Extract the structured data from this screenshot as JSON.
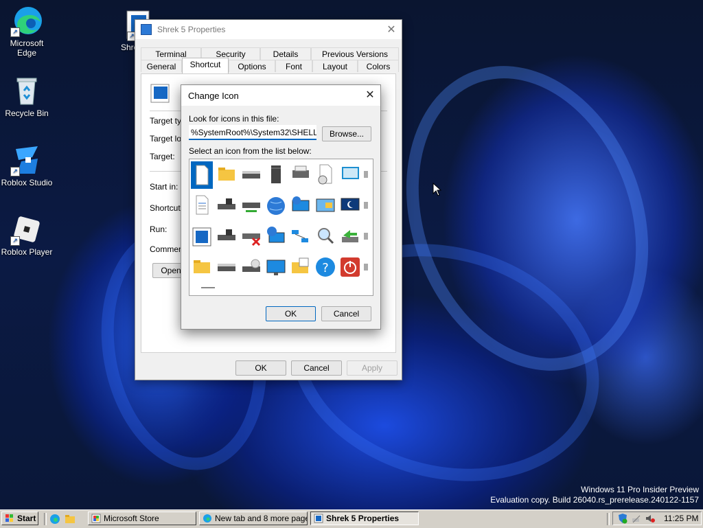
{
  "desktop": {
    "icons": [
      {
        "label": "Microsoft Edge",
        "name": "edge"
      },
      {
        "label": "Recycle Bin",
        "name": "recycle-bin"
      },
      {
        "label": "Roblox Studio",
        "name": "roblox-studio"
      },
      {
        "label": "Roblox Player",
        "name": "roblox-player"
      },
      {
        "label": "Shre",
        "name": "shrek-shortcut"
      }
    ],
    "watermark_line1": "Windows 11 Pro Insider Preview",
    "watermark_line2": "Evaluation copy. Build 26040.rs_prerelease.240122-1157"
  },
  "properties": {
    "title": "Shrek 5 Properties",
    "tabs_row1": [
      "Terminal",
      "Security",
      "Details",
      "Previous Versions"
    ],
    "tabs_row2": [
      "General",
      "Shortcut",
      "Options",
      "Font",
      "Layout",
      "Colors"
    ],
    "active_tab": "Shortcut",
    "labels": {
      "target_type": "Target typ",
      "target_location": "Target loc",
      "target": "Target:",
      "start_in": "Start in:",
      "shortcut_key": "Shortcut k",
      "run": "Run:",
      "comment": "Comment:"
    },
    "open_button": "Open",
    "ok": "OK",
    "cancel": "Cancel",
    "apply": "Apply"
  },
  "change_icon": {
    "title": "Change Icon",
    "look_label": "Look for icons in this file:",
    "path_value": "%SystemRoot%\\System32\\SHELL32",
    "browse": "Browse...",
    "select_label": "Select an icon from the list below:",
    "ok": "OK",
    "cancel": "Cancel",
    "icons": [
      "blank-document-icon",
      "folder-icon",
      "drive-icon",
      "memory-chip-icon",
      "printer-icon",
      "clock-document-icon",
      "window-icon",
      "partial-icon",
      "text-document-icon",
      "floppy-drive-icon",
      "network-drive-icon",
      "globe-icon",
      "network-monitor-icon",
      "control-panel-icon",
      "sleep-monitor-icon",
      "partial-icon",
      "application-window-icon",
      "floppy-drive-icon",
      "disconnected-drive-icon",
      "network-globe-icon",
      "network-icon",
      "search-icon",
      "usb-icon",
      "partial-icon",
      "folder-icon",
      "drive-icon",
      "cd-drive-icon",
      "monitor-icon",
      "folder-grid-icon",
      "help-icon",
      "power-icon",
      "partial-icon"
    ]
  },
  "taskbar": {
    "start": "Start",
    "items": [
      {
        "label": "Microsoft Store",
        "name": "taskbar-microsoft-store"
      },
      {
        "label": "New tab and 8 more page...",
        "name": "taskbar-edge-tabs"
      },
      {
        "label": "Shrek 5 Properties",
        "name": "taskbar-shrek-properties"
      }
    ],
    "clock": "11:25 PM"
  }
}
